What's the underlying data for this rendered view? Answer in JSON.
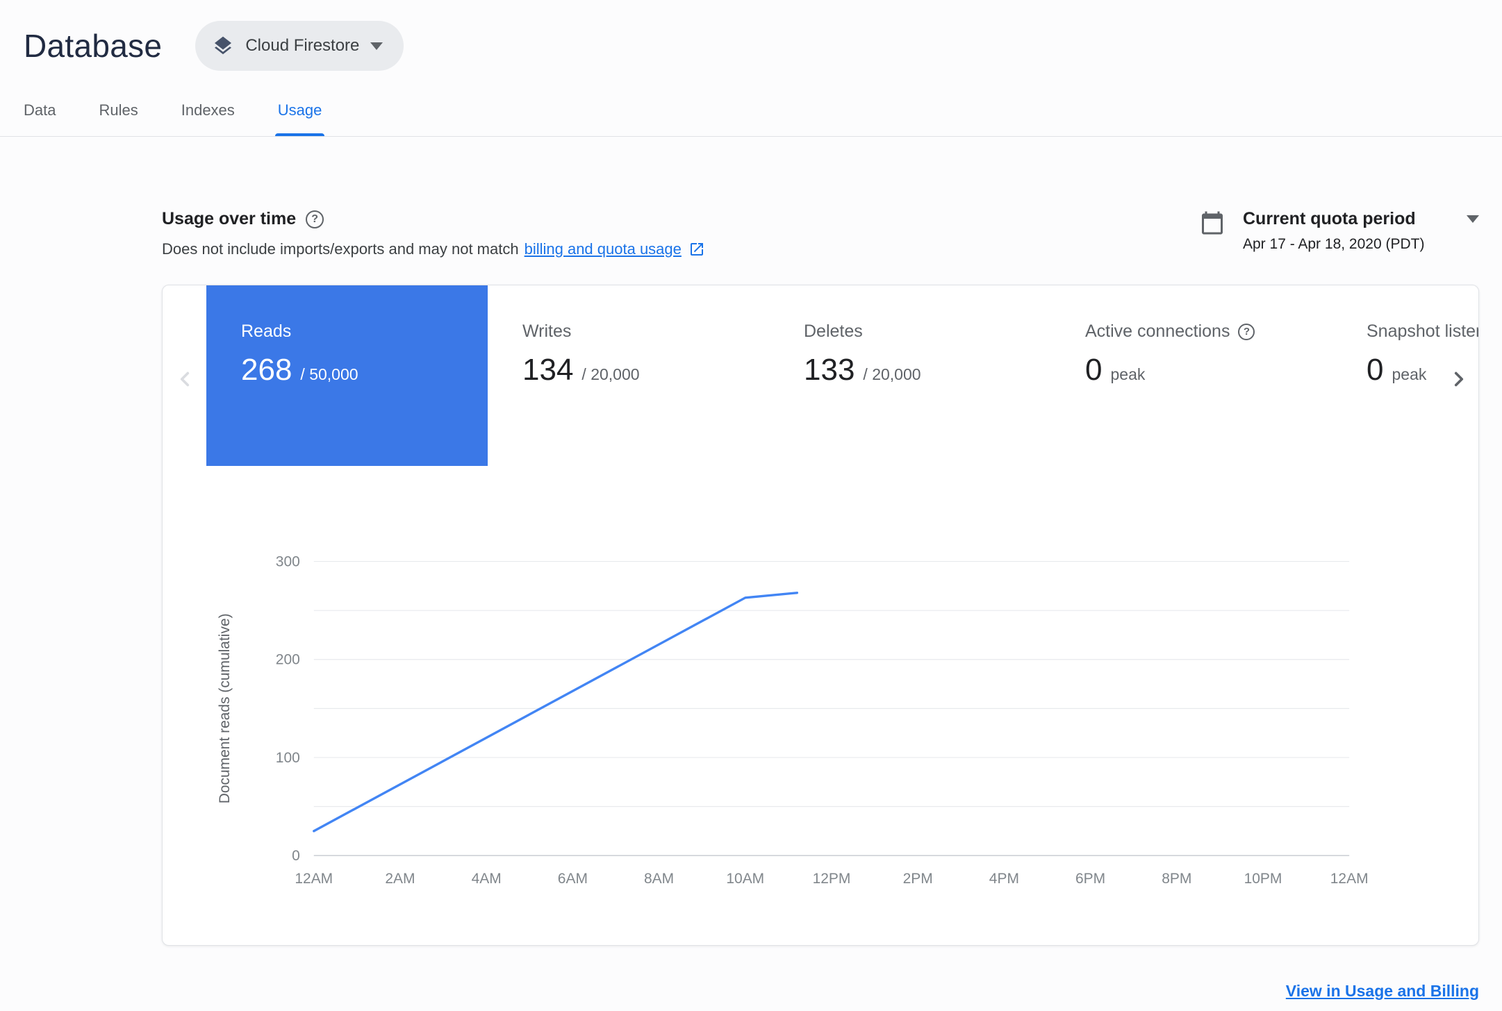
{
  "header": {
    "title": "Database",
    "product_selector": {
      "label": "Cloud Firestore"
    }
  },
  "tabs": [
    {
      "label": "Data",
      "active": false
    },
    {
      "label": "Rules",
      "active": false
    },
    {
      "label": "Indexes",
      "active": false
    },
    {
      "label": "Usage",
      "active": true
    }
  ],
  "usage_section": {
    "title": "Usage over time",
    "description_prefix": "Does not include imports/exports and may not match",
    "description_link": "billing and quota usage",
    "period_selector": {
      "label": "Current quota period",
      "range": "Apr 17 - Apr 18, 2020 (PDT)"
    }
  },
  "metric_tabs": [
    {
      "label": "Reads",
      "value": "268",
      "suffix": "/ 50,000",
      "selected": true,
      "has_help": false
    },
    {
      "label": "Writes",
      "value": "134",
      "suffix": "/ 20,000",
      "selected": false,
      "has_help": false
    },
    {
      "label": "Deletes",
      "value": "133",
      "suffix": "/ 20,000",
      "selected": false,
      "has_help": false
    },
    {
      "label": "Active connections",
      "value": "0",
      "suffix": "peak",
      "selected": false,
      "has_help": true
    },
    {
      "label": "Snapshot listeners",
      "value": "0",
      "suffix": "peak",
      "selected": false,
      "has_help": false
    }
  ],
  "chart_data": {
    "type": "line",
    "title": "",
    "xlabel": "",
    "ylabel": "Document reads (cumulative)",
    "x_tick_labels": [
      "12AM",
      "2AM",
      "4AM",
      "6AM",
      "8AM",
      "10AM",
      "12PM",
      "2PM",
      "4PM",
      "6PM",
      "8PM",
      "10PM",
      "12AM"
    ],
    "x_range_hours": [
      0,
      24
    ],
    "ylim": [
      0,
      300
    ],
    "y_tick_step": 50,
    "y_label_step": 100,
    "grid": true,
    "legend": false,
    "series": [
      {
        "name": "Document reads (cumulative)",
        "color": "#4285f4",
        "points": [
          {
            "hour": 0,
            "value": 25
          },
          {
            "hour": 10,
            "value": 263
          },
          {
            "hour": 11.2,
            "value": 268
          }
        ]
      }
    ]
  },
  "footer": {
    "link": "View in Usage and Billing"
  },
  "colors": {
    "accent": "#1a73e8",
    "selected_metric_bg": "#3b78e7",
    "chart_line": "#4285f4",
    "grid_line": "#e8eaed",
    "axis_line": "#c9cdd2"
  }
}
